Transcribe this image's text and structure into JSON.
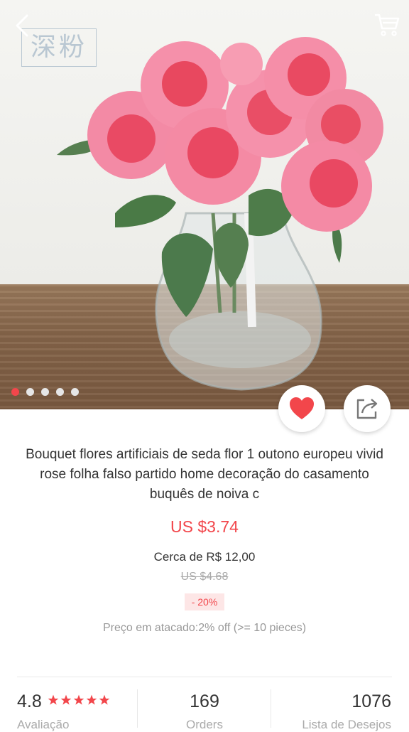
{
  "hero": {
    "stamp_text": "深粉",
    "slide_count": 5,
    "active_slide": 1
  },
  "nav": {
    "back_icon": "back-arrow-icon",
    "cart_icon": "cart-icon"
  },
  "product": {
    "title": "Bouquet flores artificiais de seda flor 1 outono europeu vivid rose folha falso partido home decoração do casamento buquês de noiva c",
    "price": "US $3.74",
    "approx_price": "Cerca de R$ 12,00",
    "old_price": "US $4.68",
    "discount": "- 20%",
    "wholesale": "Preço em atacado:2% off (>= 10 pieces)"
  },
  "actions": {
    "favorite_icon": "heart-icon",
    "share_icon": "share-icon"
  },
  "stats": {
    "rating_value": "4.8",
    "rating_stars": 5,
    "rating_label": "Avaliação",
    "orders_value": "169",
    "orders_label": "Orders",
    "wishlist_value": "1076",
    "wishlist_label": "Lista de Desejos"
  },
  "colors": {
    "accent": "#f2464b",
    "text": "#333333",
    "muted": "#999999"
  }
}
